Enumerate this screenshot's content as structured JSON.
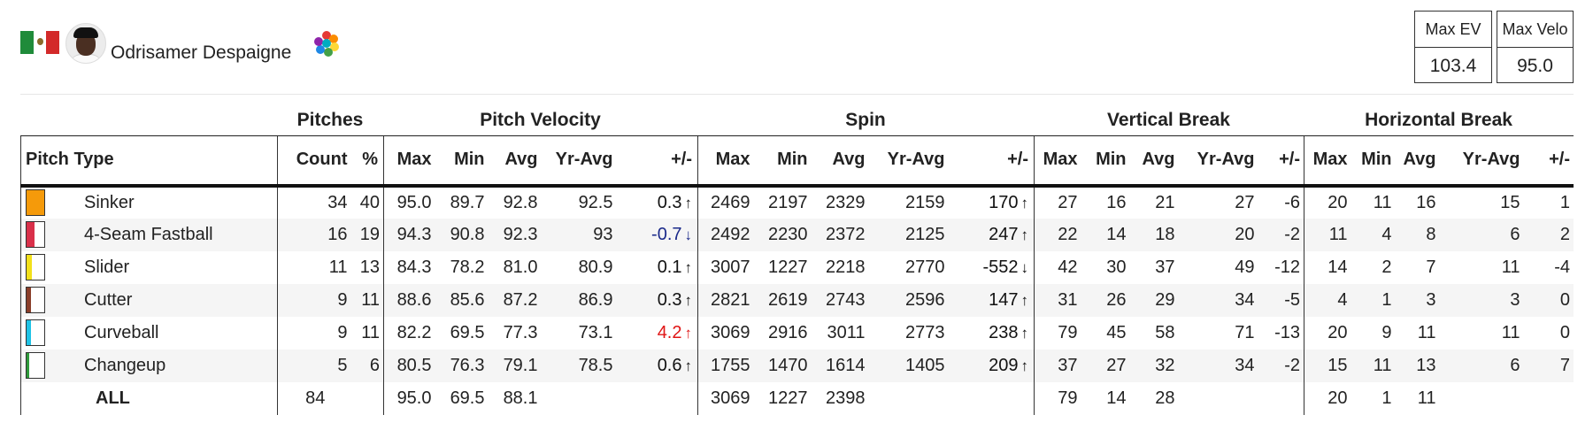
{
  "player": {
    "name": "Odrisamer Despaigne"
  },
  "stat_boxes": [
    {
      "label": "Max EV",
      "value": "103.4"
    },
    {
      "label": "Max Velo",
      "value": "95.0"
    }
  ],
  "groups": {
    "pitches": "Pitches",
    "velocity": "Pitch Velocity",
    "spin": "Spin",
    "vbreak": "Vertical Break",
    "hbreak": "Horizontal Break"
  },
  "columns": {
    "pitch_type": "Pitch Type",
    "count": "Count",
    "pct": "%",
    "max": "Max",
    "min": "Min",
    "avg": "Avg",
    "yr_avg": "Yr-Avg",
    "diff": "+/-"
  },
  "rows": [
    {
      "name": "Sinker",
      "color": "#f59a0a",
      "swatch_fill": 1.0,
      "count": "34",
      "pct": "40",
      "velo": [
        "95.0",
        "89.7",
        "92.8",
        "92.5"
      ],
      "velo_diff": "0.3",
      "velo_dir": "up",
      "velo_color": "#111111",
      "spin": [
        "2469",
        "2197",
        "2329",
        "2159"
      ],
      "spin_diff": "170",
      "spin_dir": "up",
      "vb": [
        "27",
        "16",
        "21",
        "27"
      ],
      "vb_diff": "-6",
      "hb": [
        "20",
        "11",
        "16",
        "15"
      ],
      "hb_diff": "1"
    },
    {
      "name": "4-Seam Fastball",
      "color": "#d9304a",
      "swatch_fill": 0.45,
      "count": "16",
      "pct": "19",
      "velo": [
        "94.3",
        "90.8",
        "92.3",
        "93"
      ],
      "velo_diff": "-0.7",
      "velo_dir": "down",
      "velo_color": "#1b2a8a",
      "spin": [
        "2492",
        "2230",
        "2372",
        "2125"
      ],
      "spin_diff": "247",
      "spin_dir": "up",
      "vb": [
        "22",
        "14",
        "18",
        "20"
      ],
      "vb_diff": "-2",
      "hb": [
        "11",
        "4",
        "8",
        "6"
      ],
      "hb_diff": "2"
    },
    {
      "name": "Slider",
      "color": "#f2e01a",
      "swatch_fill": 0.3,
      "count": "11",
      "pct": "13",
      "velo": [
        "84.3",
        "78.2",
        "81.0",
        "80.9"
      ],
      "velo_diff": "0.1",
      "velo_dir": "up",
      "velo_color": "#111111",
      "spin": [
        "3007",
        "1227",
        "2218",
        "2770"
      ],
      "spin_diff": "-552",
      "spin_dir": "down",
      "vb": [
        "42",
        "30",
        "37",
        "49"
      ],
      "vb_diff": "-12",
      "hb": [
        "14",
        "2",
        "7",
        "11"
      ],
      "hb_diff": "-4"
    },
    {
      "name": "Cutter",
      "color": "#8a3e2a",
      "swatch_fill": 0.25,
      "count": "9",
      "pct": "11",
      "velo": [
        "88.6",
        "85.6",
        "87.2",
        "86.9"
      ],
      "velo_diff": "0.3",
      "velo_dir": "up",
      "velo_color": "#111111",
      "spin": [
        "2821",
        "2619",
        "2743",
        "2596"
      ],
      "spin_diff": "147",
      "spin_dir": "up",
      "vb": [
        "31",
        "26",
        "29",
        "34"
      ],
      "vb_diff": "-5",
      "hb": [
        "4",
        "1",
        "3",
        "3"
      ],
      "hb_diff": "0"
    },
    {
      "name": "Curveball",
      "color": "#1fc3e6",
      "swatch_fill": 0.25,
      "count": "9",
      "pct": "11",
      "velo": [
        "82.2",
        "69.5",
        "77.3",
        "73.1"
      ],
      "velo_diff": "4.2",
      "velo_dir": "up",
      "velo_color": "#e01515",
      "spin": [
        "3069",
        "2916",
        "3011",
        "2773"
      ],
      "spin_diff": "238",
      "spin_dir": "up",
      "vb": [
        "79",
        "45",
        "58",
        "71"
      ],
      "vb_diff": "-13",
      "hb": [
        "20",
        "9",
        "11",
        "11"
      ],
      "hb_diff": "0"
    },
    {
      "name": "Changeup",
      "color": "#2e9a3a",
      "swatch_fill": 0.15,
      "count": "5",
      "pct": "6",
      "velo": [
        "80.5",
        "76.3",
        "79.1",
        "78.5"
      ],
      "velo_diff": "0.6",
      "velo_dir": "up",
      "velo_color": "#111111",
      "spin": [
        "1755",
        "1470",
        "1614",
        "1405"
      ],
      "spin_diff": "209",
      "spin_dir": "up",
      "vb": [
        "37",
        "27",
        "32",
        "34"
      ],
      "vb_diff": "-2",
      "hb": [
        "15",
        "11",
        "13",
        "6"
      ],
      "hb_diff": "7"
    }
  ],
  "total": {
    "name": "ALL",
    "count": "84",
    "velo": [
      "95.0",
      "69.5",
      "88.1"
    ],
    "spin": [
      "3069",
      "1227",
      "2398"
    ],
    "vb": [
      "79",
      "14",
      "28"
    ],
    "hb": [
      "20",
      "1",
      "11"
    ]
  },
  "icons": {
    "arrow_up": "↑",
    "arrow_down": "↓"
  }
}
